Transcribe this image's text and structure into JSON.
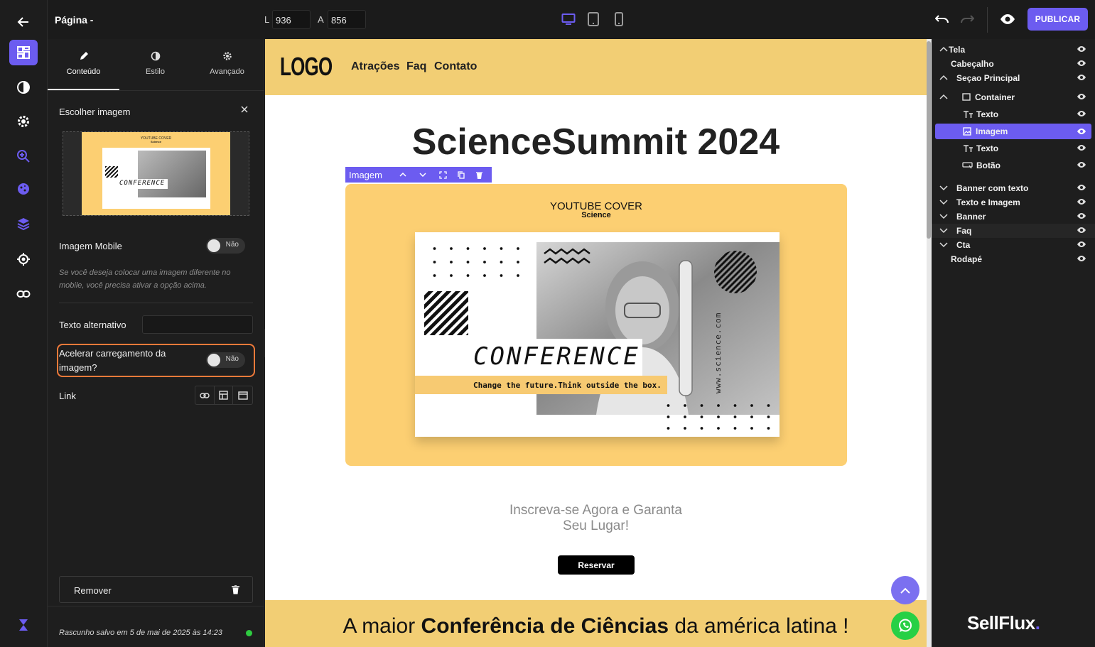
{
  "topbar": {
    "page_title": "Página -",
    "width_label": "L",
    "width_value": "936",
    "height_label": "A",
    "height_value": "856",
    "publish_label": "PUBLICAR"
  },
  "left_panel": {
    "tabs": [
      {
        "label": "Conteúdo",
        "active": true
      },
      {
        "label": "Estilo"
      },
      {
        "label": "Avançado"
      }
    ],
    "choose_image_label": "Escolher imagem",
    "thumb_title": "YOUTUBE COVER",
    "thumb_sub": "Science",
    "thumb_conf": "CONFERENCE",
    "mobile_image_label": "Imagem Mobile",
    "mobile_toggle": "Não",
    "mobile_help": "Se você deseja colocar uma imagem diferente no mobile, você precisa ativar a opção acima.",
    "alt_text_label": "Texto alternativo",
    "alt_text_value": "",
    "lazy_label_1": "Acelerar carregamento da",
    "lazy_label_2": "imagem?",
    "lazy_toggle": "Não",
    "link_label": "Link",
    "remove_label": "Remover",
    "draft_status": "Rascunho salvo em 5 de mai de 2025 às 14:23",
    "status_color": "#2ecc40"
  },
  "canvas": {
    "logo": "LOGO",
    "nav": [
      "Atrações",
      "Faq",
      "Contato"
    ],
    "title": "ScienceSummit 2024",
    "selected_tag": "Imagem",
    "cover": {
      "title": "YOUTUBE COVER",
      "subtitle": "Science",
      "conf": "CONFERENCE",
      "tagline": "Change the future.Think outside the box.",
      "url": "www.science.com"
    },
    "cta_text_1": "Inscreva-se Agora e Garanta",
    "cta_text_2": "Seu Lugar!",
    "reserve_label": "Reservar",
    "banner_pre": "A maior ",
    "banner_bold": "Conferência de Ciências",
    "banner_post": " da américa latina !"
  },
  "tree": {
    "items": [
      {
        "label": "Tela"
      },
      {
        "label": "Cabeçalho"
      },
      {
        "label": "Seçao Principal"
      },
      {
        "label": "Container"
      },
      {
        "label": "Texto"
      },
      {
        "label": "Imagem",
        "selected": true
      },
      {
        "label": "Texto"
      },
      {
        "label": "Botão"
      },
      {
        "label": "Banner com texto"
      },
      {
        "label": "Texto e Imagem"
      },
      {
        "label": "Banner"
      },
      {
        "label": "Faq"
      },
      {
        "label": "Cta"
      },
      {
        "label": "Rodapé"
      }
    ],
    "brand": "SellFlux"
  },
  "colors": {
    "accent": "#6c5cf0",
    "highlight_border": "#f07a3a",
    "header_yellow": "#f2ce74",
    "cover_yellow": "#fccf72"
  }
}
